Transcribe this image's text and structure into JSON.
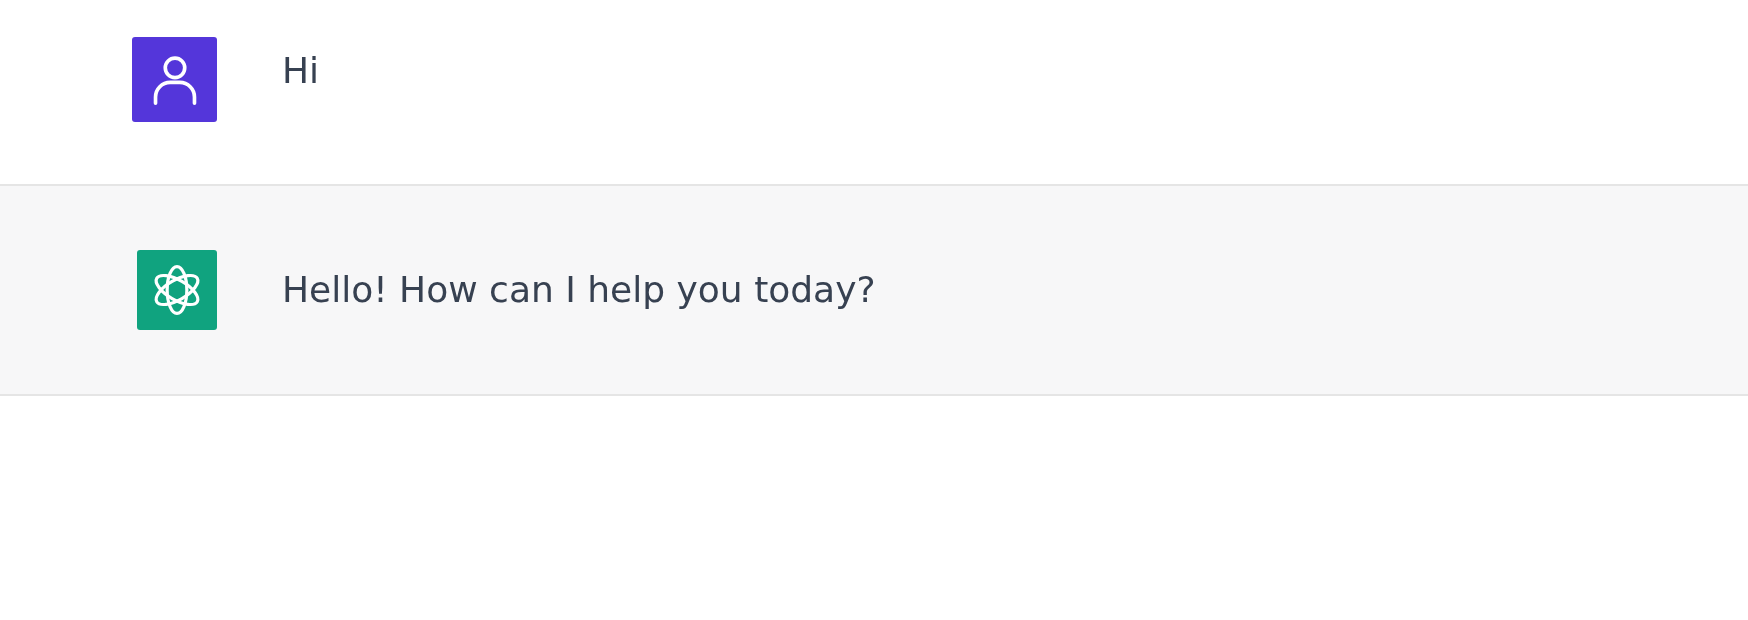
{
  "messages": [
    {
      "kind": "user",
      "text": "Hi"
    },
    {
      "kind": "assistant",
      "text": "Hello! How can I help you today?"
    }
  ]
}
